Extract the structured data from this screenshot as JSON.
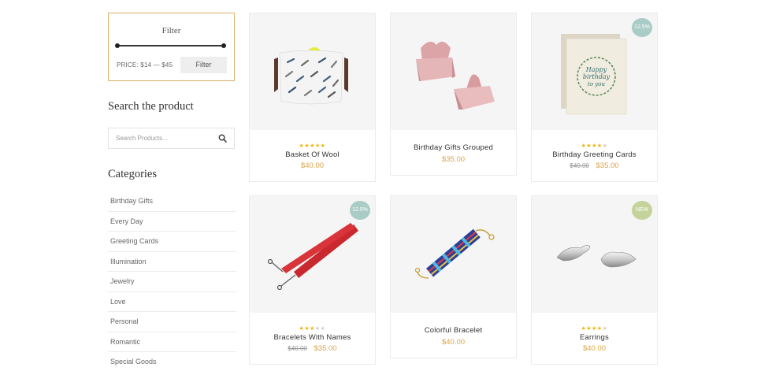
{
  "filter": {
    "title": "Filter",
    "price_text": "PRICE: $14 — $45",
    "button_label": "Filter"
  },
  "search": {
    "heading": "Search the product",
    "placeholder": "Search Products..."
  },
  "categories": {
    "heading": "Categories",
    "items": [
      "Birthday Gifts",
      "Every Day",
      "Greeting Cards",
      "Illumination",
      "Jewelry",
      "Love",
      "Personal",
      "Romantic",
      "Special Goods"
    ]
  },
  "products": [
    {
      "name": "Basket Of Wool",
      "rating": 5,
      "old_price": "",
      "price": "$40.00",
      "badge": "",
      "image": "wool-basket"
    },
    {
      "name": "Birthday Gifts Grouped",
      "rating": 0,
      "old_price": "",
      "price": "$35.00",
      "badge": "",
      "image": "pink-gift-boxes"
    },
    {
      "name": "Birthday Greeting Cards",
      "rating": 4,
      "old_price": "$40.00",
      "price": "$35.00",
      "badge": "12.5%",
      "image": "greeting-card"
    },
    {
      "name": "Bracelets With Names",
      "rating": 3,
      "old_price": "$40.00",
      "price": "$35.00",
      "badge": "12.5%",
      "image": "red-lanyard"
    },
    {
      "name": "Colorful Bracelet",
      "rating": 0,
      "old_price": "",
      "price": "$40.00",
      "badge": "",
      "image": "beaded-bracelet"
    },
    {
      "name": "Earrings",
      "rating": 4.5,
      "old_price": "",
      "price": "$40.00",
      "badge": "NEW",
      "image": "silver-bird-earrings"
    }
  ],
  "colors": {
    "accent_gold": "#d9b26b",
    "price": "#d9a54a",
    "sale_badge": "#a9ccc6",
    "new_badge": "#c5d39a",
    "star": "#f0b400"
  }
}
